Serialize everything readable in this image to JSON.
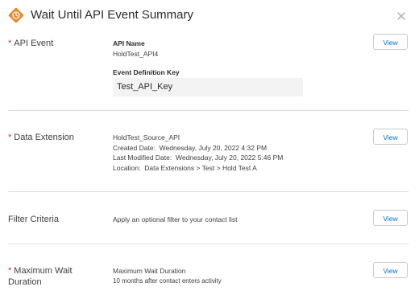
{
  "modal": {
    "title": "Wait Until API Event Summary",
    "accent_color": "#e8882f"
  },
  "api_event": {
    "label": "API Event",
    "required_marker": "*",
    "api_name_heading": "API Name",
    "api_name_value": "HoldTest_API4",
    "event_key_heading": "Event Definition Key",
    "event_key_value": "Test_API_Key",
    "view_label": "View"
  },
  "data_extension": {
    "label": "Data Extension",
    "required_marker": "*",
    "name": "HoldTest_Source_API",
    "created_label": "Created Date:",
    "created_value": "Wednesday, July 20, 2022 4:32 PM",
    "modified_label": "Last Modified Date:",
    "modified_value": "Wednesday, July 20, 2022 5:46 PM",
    "location_label": "Location:",
    "location_value": "Data Extensions > Test > Hold Test A",
    "view_label": "View"
  },
  "filter_criteria": {
    "label": "Filter Criteria",
    "description": "Apply an optional filter to your contact list",
    "view_label": "View"
  },
  "max_wait": {
    "label_line1": "Maximum Wait",
    "label_line2": "Duration",
    "required_marker": "*",
    "heading": "Maximum Wait Duration",
    "value": "10 months after contact enters activity",
    "view_label": "View"
  },
  "icons": {
    "header": "wait-until-icon",
    "close": "close-icon"
  }
}
